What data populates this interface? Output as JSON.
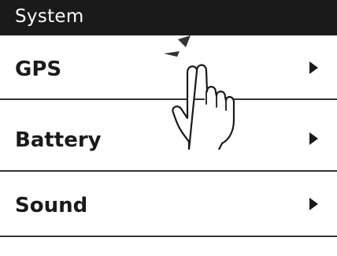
{
  "header": {
    "title": "System"
  },
  "menu": {
    "items": [
      {
        "label": "GPS",
        "icon": "chevron-right-icon"
      },
      {
        "label": "Battery",
        "icon": "chevron-right-icon"
      },
      {
        "label": "Sound",
        "icon": "chevron-right-icon"
      }
    ]
  },
  "gesture": {
    "icon": "tap-hand-icon",
    "target": "GPS"
  },
  "colors": {
    "background": "#ffffff",
    "title_bar": "#1a1a1a",
    "title_text": "#ffffff",
    "text": "#1a1a1a",
    "divider": "#333333"
  }
}
